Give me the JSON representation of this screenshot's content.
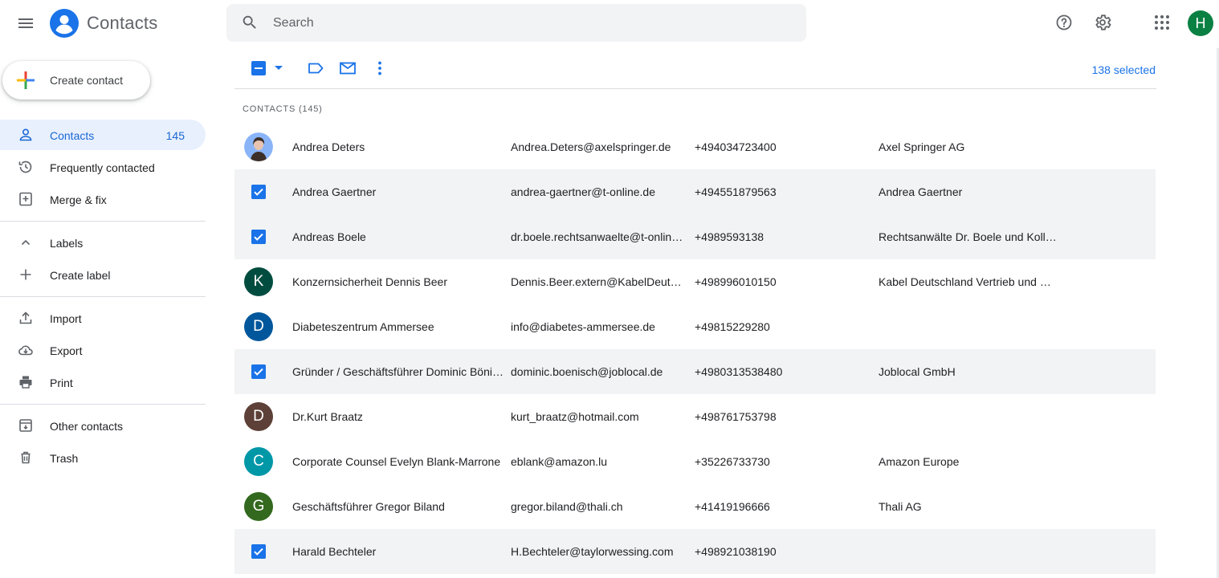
{
  "header": {
    "app_title": "Contacts",
    "search_placeholder": "Search",
    "user_initial": "H",
    "icons": [
      "menu-icon",
      "contacts-logo-icon",
      "search-icon",
      "help-icon",
      "settings-icon",
      "apps-grid-icon"
    ]
  },
  "sidebar": {
    "create_label": "Create contact",
    "items": [
      {
        "label": "Contacts",
        "count": "145",
        "icon": "person-icon",
        "active": true
      },
      {
        "label": "Frequently contacted",
        "icon": "history-icon"
      },
      {
        "label": "Merge & fix",
        "icon": "merge-fix-icon"
      },
      {
        "label": "Labels",
        "icon": "chevron-up-icon"
      },
      {
        "label": "Create label",
        "icon": "plus-icon"
      },
      {
        "label": "Import",
        "icon": "upload-icon"
      },
      {
        "label": "Export",
        "icon": "cloud-download-icon"
      },
      {
        "label": "Print",
        "icon": "print-icon"
      },
      {
        "label": "Other contacts",
        "icon": "archive-icon"
      },
      {
        "label": "Trash",
        "icon": "trash-icon"
      }
    ]
  },
  "toolbar": {
    "selected_text": "138 selected",
    "icons": [
      "select-partial-checkbox-icon",
      "dropdown-arrow-icon",
      "label-icon",
      "email-icon",
      "more-vert-icon"
    ]
  },
  "section_title": "CONTACTS (145)",
  "colors": {
    "accent": "#1a73e8",
    "active_bg": "#e8f0fe",
    "row_selected_bg": "#f1f3f4"
  },
  "contacts": [
    {
      "name": "Andrea Deters",
      "email": "Andrea.Deters@axelspringer.de",
      "phone": "+494034723400",
      "org": "Axel Springer AG",
      "checked": false,
      "avatar": "photo",
      "initial": "",
      "color": "#8ab4f8"
    },
    {
      "name": "Andrea Gaertner",
      "email": "andrea-gaertner@t-online.de",
      "phone": "+494551879563",
      "org": "Andrea Gaertner",
      "checked": true
    },
    {
      "name": "Andreas Boele",
      "email": "dr.boele.rechtsanwaelte@t-online.de",
      "phone": "+4989593138",
      "org": "Rechtsanwälte Dr. Boele und Kollegen",
      "checked": true
    },
    {
      "name": "Konzernsicherheit Dennis Beer",
      "email": "Dennis.Beer.extern@KabelDeutschland.de",
      "phone": "+498996010150",
      "org": "Kabel Deutschland Vertrieb und Service",
      "checked": false,
      "initial": "K",
      "color": "#004d40"
    },
    {
      "name": "Diabeteszentrum Ammersee",
      "email": "info@diabetes-ammersee.de",
      "phone": "+49815229280",
      "org": "",
      "checked": false,
      "initial": "D",
      "color": "#01579b"
    },
    {
      "name": "Gründer / Geschäftsführer Dominic Bönisch",
      "email": "dominic.boenisch@joblocal.de",
      "phone": "+4980313538480",
      "org": "Joblocal GmbH",
      "checked": true
    },
    {
      "name": "Dr.Kurt Braatz",
      "email": "kurt_braatz@hotmail.com",
      "phone": "+498761753798",
      "org": "",
      "checked": false,
      "initial": "D",
      "color": "#5d4037"
    },
    {
      "name": "Corporate Counsel Evelyn Blank-Marrone",
      "email": "eblank@amazon.lu",
      "phone": "+35226733730",
      "org": "Amazon Europe",
      "checked": false,
      "initial": "C",
      "color": "#0097a7"
    },
    {
      "name": "Geschäftsführer Gregor Biland",
      "email": "gregor.biland@thali.ch",
      "phone": "+41419196666",
      "org": "Thali AG",
      "checked": false,
      "initial": "G",
      "color": "#33691e"
    },
    {
      "name": "Harald Bechteler",
      "email": "H.Bechteler@taylorwessing.com",
      "phone": "+498921038190",
      "org": "",
      "checked": true
    }
  ]
}
